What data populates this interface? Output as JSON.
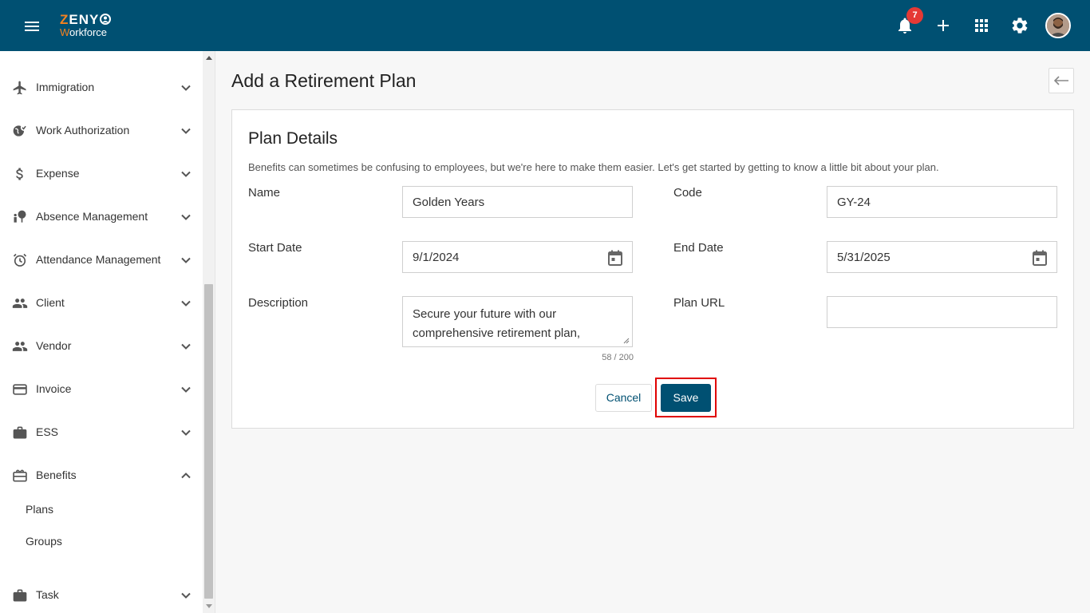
{
  "header": {
    "logo_top_initial": "Z",
    "logo_top_rest": "ENY",
    "logo_bottom_initial": "W",
    "logo_bottom_rest": "orkforce",
    "notification_count": "7",
    "icons": [
      "menu-icon",
      "bell-icon",
      "plus-icon",
      "apps-icon",
      "gear-icon",
      "avatar"
    ],
    "brand_color": "#005072",
    "accent_color": "#f58220",
    "badge_color": "#e53935"
  },
  "sidebar": {
    "items": [
      {
        "label": "Immigration",
        "icon": "airplane-icon",
        "expanded": false
      },
      {
        "label": "Work Authorization",
        "icon": "globe-check-icon",
        "expanded": false
      },
      {
        "label": "Expense",
        "icon": "dollar-icon",
        "expanded": false
      },
      {
        "label": "Absence Management",
        "icon": "person-tree-icon",
        "expanded": false
      },
      {
        "label": "Attendance Management",
        "icon": "alarm-clock-icon",
        "expanded": false
      },
      {
        "label": "Client",
        "icon": "people-icon",
        "expanded": false
      },
      {
        "label": "Vendor",
        "icon": "people-icon",
        "expanded": false
      },
      {
        "label": "Invoice",
        "icon": "card-icon",
        "expanded": false
      },
      {
        "label": "ESS",
        "icon": "briefcase-icon",
        "expanded": false
      },
      {
        "label": "Benefits",
        "icon": "gift-card-icon",
        "expanded": true
      },
      {
        "label": "Task",
        "icon": "briefcase-icon",
        "expanded": false
      }
    ],
    "benefits_subitems": [
      {
        "label": "Plans"
      },
      {
        "label": "Groups"
      }
    ]
  },
  "main": {
    "page_title": "Add a Retirement Plan",
    "card": {
      "title": "Plan Details",
      "description": "Benefits can sometimes be confusing to employees, but we're here to make them easier. Let's get started by getting to know a little bit about your plan.",
      "fields": {
        "name": {
          "label": "Name",
          "value": "Golden Years"
        },
        "code": {
          "label": "Code",
          "value": "GY-24"
        },
        "start_date": {
          "label": "Start Date",
          "value": "9/1/2024"
        },
        "end_date": {
          "label": "End Date",
          "value": "5/31/2025"
        },
        "description": {
          "label": "Description",
          "value": "Secure your future with our comprehensive retirement plan,",
          "char_count": "58 / 200"
        },
        "plan_url": {
          "label": "Plan URL",
          "value": ""
        }
      },
      "cancel_label": "Cancel",
      "save_label": "Save"
    }
  }
}
